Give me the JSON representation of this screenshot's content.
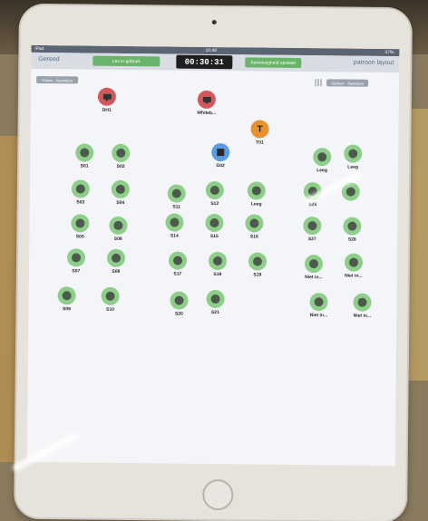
{
  "statusbar": {
    "left": "iPad",
    "time": "10:48",
    "battery": "37%"
  },
  "toolbar": {
    "back_label": "Gereed",
    "left_pill": "Les in gebruik",
    "timer": "00:30:31",
    "right_pill": "Aanwezigheid opslaan",
    "right_link": "patroon layout"
  },
  "controls": {
    "left_btn": "Sluiten · Aanwijzen",
    "right_btn": "Opslaan · Aanwijzen"
  },
  "seats": [
    {
      "label": "DH1",
      "kind": "red"
    },
    {
      "label": "Whiteb...",
      "kind": "red"
    },
    {
      "label": "T01",
      "kind": "teacher",
      "glyph": "T"
    },
    {
      "label": "G02",
      "kind": "blue"
    },
    {
      "label": "S01"
    },
    {
      "label": "S02"
    },
    {
      "label": "Leeg"
    },
    {
      "label": "Leeg"
    },
    {
      "label": "S03"
    },
    {
      "label": "S04"
    },
    {
      "label": "S11"
    },
    {
      "label": "S12"
    },
    {
      "label": "Leeg"
    },
    {
      "label": "S25"
    },
    {
      "label": ""
    },
    {
      "label": "S05"
    },
    {
      "label": "S06"
    },
    {
      "label": "S14"
    },
    {
      "label": "S15"
    },
    {
      "label": "S16"
    },
    {
      "label": "S27"
    },
    {
      "label": "S28"
    },
    {
      "label": "S07"
    },
    {
      "label": "S08"
    },
    {
      "label": "S17"
    },
    {
      "label": "S18"
    },
    {
      "label": "S19"
    },
    {
      "label": "Niet in..."
    },
    {
      "label": "Niet in..."
    },
    {
      "label": "S09"
    },
    {
      "label": "S10"
    },
    {
      "label": "S20"
    },
    {
      "label": "S21"
    },
    {
      "label": "Niet in..."
    },
    {
      "label": "Niet in..."
    }
  ],
  "colors": {
    "seat": "#8fce8a",
    "teacher": "#e7912f",
    "red": "#d2585b",
    "blue": "#5b9be0",
    "pill": "#69b46a"
  }
}
